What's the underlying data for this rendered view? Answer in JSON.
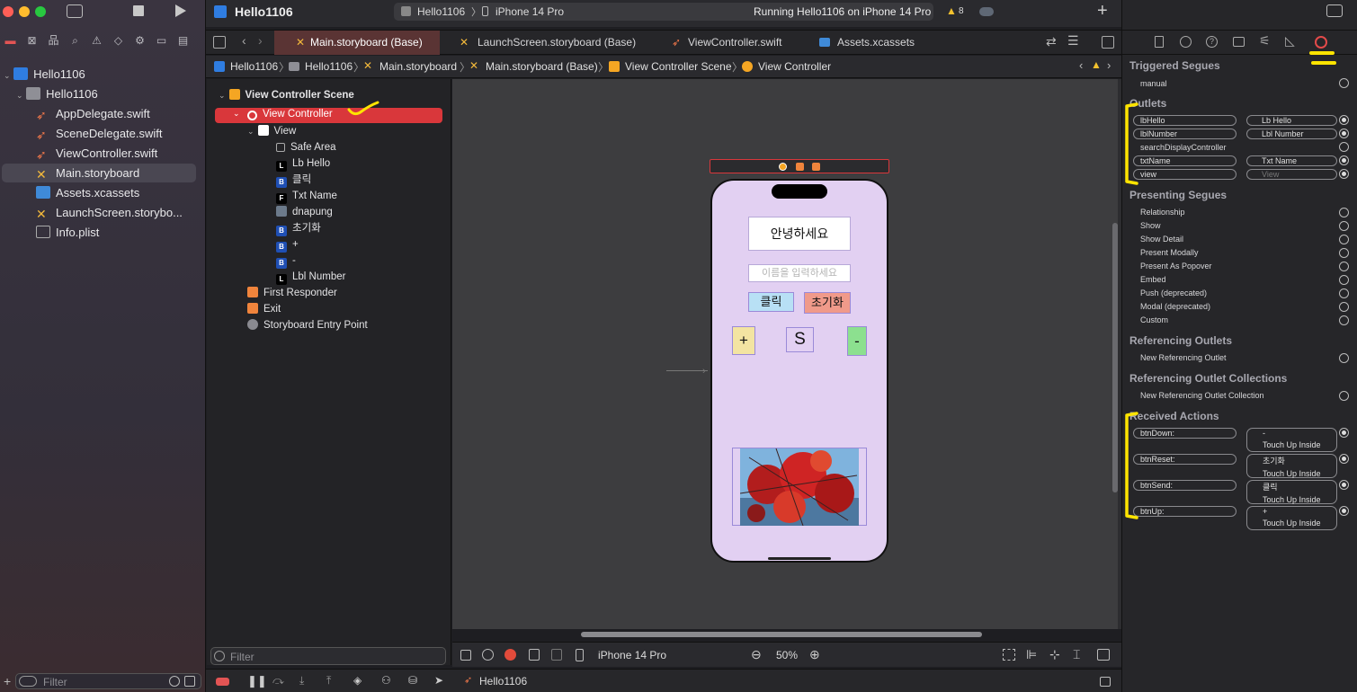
{
  "project": {
    "name": "Hello1106",
    "scheme": "Hello1106",
    "device": "iPhone 14 Pro",
    "status": "Running Hello1106 on iPhone 14 Pro",
    "warnings": "8"
  },
  "navigator": {
    "root": "Hello1106",
    "group": "Hello1106",
    "files": [
      "AppDelegate.swift",
      "SceneDelegate.swift",
      "ViewController.swift",
      "Main.storyboard",
      "Assets.xcassets",
      "LaunchScreen.storybo...",
      "Info.plist"
    ],
    "filter_placeholder": "Filter"
  },
  "tabs": [
    "Main.storyboard (Base)",
    "LaunchScreen.storyboard (Base)",
    "ViewController.swift",
    "Assets.xcassets"
  ],
  "jumpbar": [
    "Hello1106",
    "Hello1106",
    "Main.storyboard",
    "Main.storyboard (Base)",
    "View Controller Scene",
    "View Controller"
  ],
  "outline": {
    "scene": "View Controller Scene",
    "items": [
      "View Controller",
      "View",
      "Safe Area",
      "Lb Hello",
      "클릭",
      "Txt Name",
      "dnapung",
      "초기화",
      "+",
      "-",
      "Lbl Number",
      "First Responder",
      "Exit",
      "Storyboard Entry Point"
    ],
    "badges": [
      "L",
      "B",
      "F",
      "B",
      "B",
      "B",
      "L"
    ],
    "filter_placeholder": "Filter"
  },
  "phone": {
    "greeting": "안녕하세요",
    "input_placeholder": "이름을 입력하세요",
    "click_button": "클릭",
    "reset_button": "초기화",
    "plus_button": "+",
    "number_label": "S",
    "minus_button": "-"
  },
  "canvas_bottom": {
    "device": "iPhone 14 Pro",
    "zoom": "50%"
  },
  "debug": {
    "scheme": "Hello1106"
  },
  "inspector": {
    "triggered_segues": "Triggered Segues",
    "manual": "manual",
    "outlets": "Outlets",
    "outlet_rows": [
      {
        "name": "lbHello",
        "target": "Lb Hello"
      },
      {
        "name": "lblNumber",
        "target": "Lbl Number"
      },
      {
        "name": "searchDisplayController",
        "target": ""
      },
      {
        "name": "txtName",
        "target": "Txt Name"
      },
      {
        "name": "view",
        "target": "View"
      }
    ],
    "presenting_segues": "Presenting Segues",
    "segues": [
      "Relationship",
      "Show",
      "Show Detail",
      "Present Modally",
      "Present As Popover",
      "Embed",
      "Push (deprecated)",
      "Modal (deprecated)",
      "Custom"
    ],
    "referencing_outlets": "Referencing Outlets",
    "new_ref_outlet": "New Referencing Outlet",
    "referencing_outlet_collections": "Referencing Outlet Collections",
    "new_ref_outlet_collection": "New Referencing Outlet Collection",
    "received_actions": "Received Actions",
    "actions": [
      {
        "name": "btnDown:",
        "target": "-",
        "event": "Touch Up Inside"
      },
      {
        "name": "btnReset:",
        "target": "초기화",
        "event": "Touch Up Inside"
      },
      {
        "name": "btnSend:",
        "target": "클릭",
        "event": "Touch Up Inside"
      },
      {
        "name": "btnUp:",
        "target": "+",
        "event": "Touch Up Inside"
      }
    ]
  },
  "colors": {
    "accent_red": "#d9373b",
    "annotation_yellow": "#ffe400",
    "phone_bg": "#e2d0f2"
  }
}
